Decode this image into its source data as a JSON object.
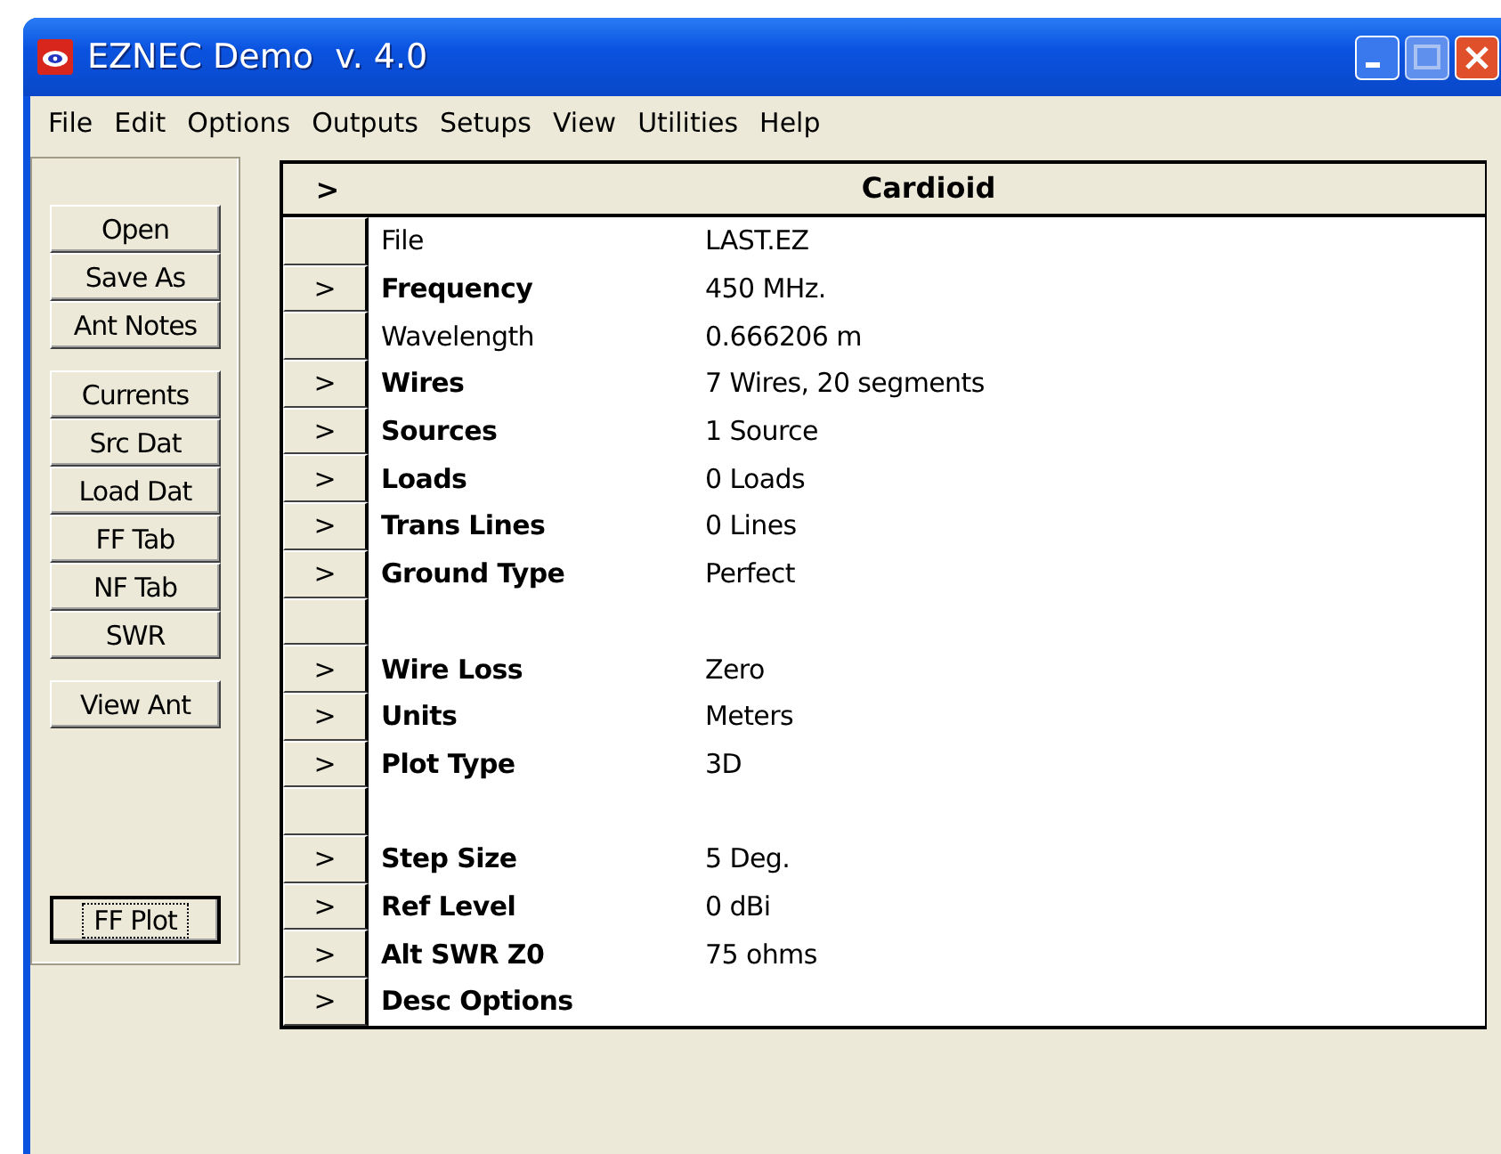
{
  "window": {
    "title": "EZNEC Demo  v. 4.0"
  },
  "menu": [
    "File",
    "Edit",
    "Options",
    "Outputs",
    "Setups",
    "View",
    "Utilities",
    "Help"
  ],
  "button_groups": [
    [
      "Open",
      "Save As",
      "Ant Notes"
    ],
    [
      "Currents",
      "Src Dat",
      "Load Dat",
      "FF Tab",
      "NF Tab",
      "SWR"
    ],
    [
      "View Ant"
    ]
  ],
  "plot_button": {
    "label": "FF Plot",
    "focused": true
  },
  "grid": {
    "header_arrow": ">",
    "title": "Cardioid",
    "rows": [
      {
        "kind": "plain",
        "arrow": "",
        "label": "File",
        "value": "LAST.EZ"
      },
      {
        "kind": "bold",
        "arrow": ">",
        "label": "Frequency",
        "value": "450 MHz."
      },
      {
        "kind": "plain",
        "arrow": "",
        "label": "Wavelength",
        "value": "0.666206 m"
      },
      {
        "kind": "bold",
        "arrow": ">",
        "label": "Wires",
        "value": "7 Wires, 20 segments"
      },
      {
        "kind": "bold",
        "arrow": ">",
        "label": "Sources",
        "value": "1 Source"
      },
      {
        "kind": "bold",
        "arrow": ">",
        "label": "Loads",
        "value": "0 Loads"
      },
      {
        "kind": "bold",
        "arrow": ">",
        "label": "Trans Lines",
        "value": "0 Lines"
      },
      {
        "kind": "bold",
        "arrow": ">",
        "label": "Ground Type",
        "value": "Perfect"
      },
      {
        "kind": "blank"
      },
      {
        "kind": "bold",
        "arrow": ">",
        "label": "Wire Loss",
        "value": "Zero"
      },
      {
        "kind": "bold",
        "arrow": ">",
        "label": "Units",
        "value": "Meters"
      },
      {
        "kind": "bold",
        "arrow": ">",
        "label": "Plot Type",
        "value": "3D"
      },
      {
        "kind": "blank"
      },
      {
        "kind": "bold",
        "arrow": ">",
        "label": "Step Size",
        "value": "5 Deg."
      },
      {
        "kind": "bold",
        "arrow": ">",
        "label": "Ref Level",
        "value": "0 dBi"
      },
      {
        "kind": "bold",
        "arrow": ">",
        "label": "Alt SWR Z0",
        "value": "75 ohms"
      },
      {
        "kind": "bold",
        "arrow": ">",
        "label": "Desc Options"
      }
    ]
  }
}
